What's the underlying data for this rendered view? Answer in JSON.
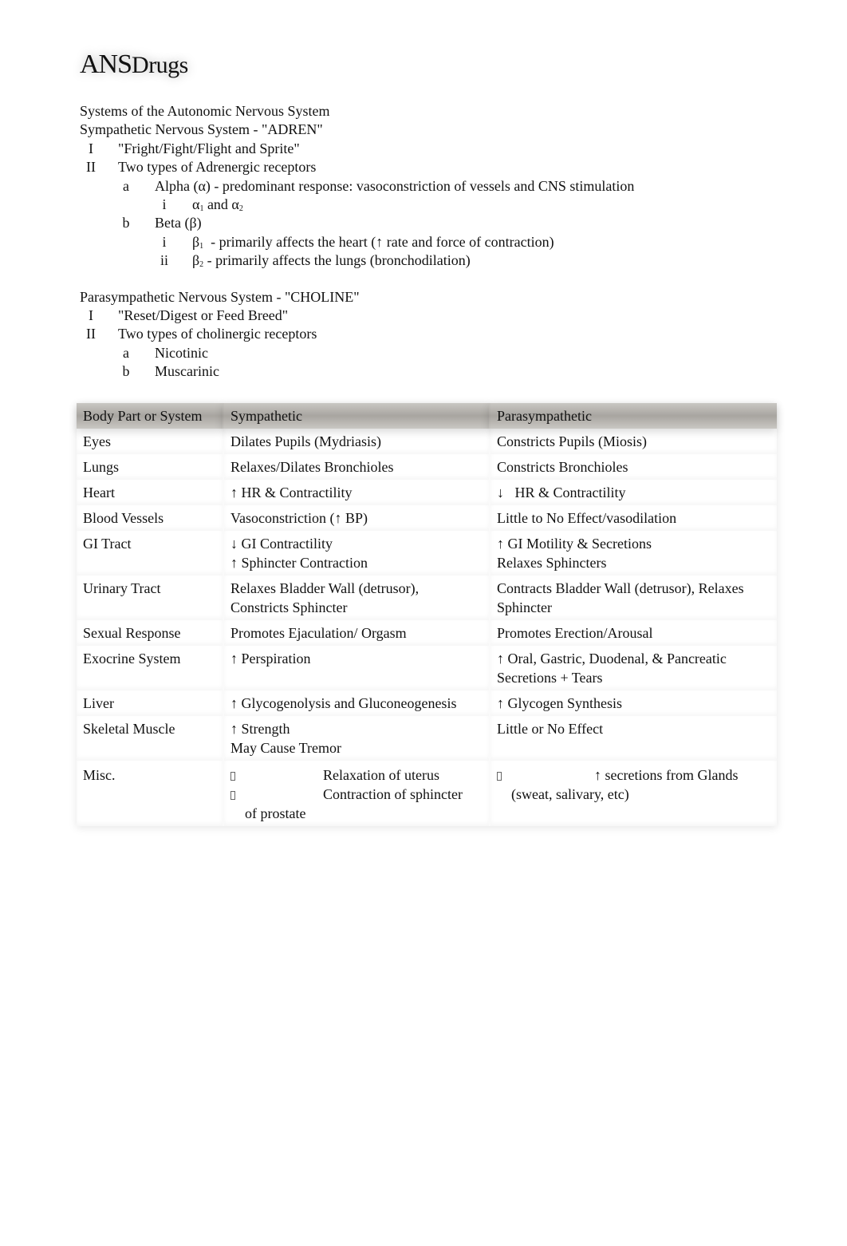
{
  "title": {
    "main": "ANS",
    "suffix": "Drugs"
  },
  "outline": {
    "heading": "Systems of the Autonomic Nervous System",
    "sympathetic": {
      "heading": "Sympathetic Nervous System  - \"ADREN\"",
      "items": [
        {
          "num": "I",
          "text": "\"Fright/Fight/Flight and Sprite\""
        },
        {
          "num": "II",
          "text": "Two types of Adrenergic receptors"
        }
      ],
      "alpha": {
        "num": "a",
        "text": "Alpha (α) - predominant response: vasoconstriction of vessels and CNS stimulation"
      },
      "alpha_sub": {
        "num": "i",
        "a": "α",
        "s1": "1",
        "mid": " and α",
        "s2": "2"
      },
      "beta": {
        "num": "b",
        "text": "Beta (β)"
      },
      "beta1": {
        "num": "i",
        "sym": "β",
        "sub": "1",
        "text": "  - primarily affects the heart (↑ rate and force of contraction)"
      },
      "beta2": {
        "num": "ii",
        "sym": "β",
        "sub": "2",
        "text": " - primarily affects the lungs (bronchodilation)"
      }
    },
    "parasympathetic": {
      "heading": "Parasympathetic Nervous System  - \"CHOLINE\"",
      "items": [
        {
          "num": "I",
          "text": "\"Reset/Digest or Feed Breed\""
        },
        {
          "num": "II",
          "text": "Two types of cholinergic receptors"
        }
      ],
      "subitems": [
        {
          "num": "a",
          "text": "Nicotinic"
        },
        {
          "num": "b",
          "text": "Muscarinic"
        }
      ]
    }
  },
  "table": {
    "headers": [
      "Body Part or System",
      "Sympathetic",
      "Parasympathetic"
    ],
    "rows": [
      {
        "part": "Eyes",
        "sym": [
          "Dilates Pupils (Mydriasis)"
        ],
        "para": [
          "Constricts Pupils (Miosis)"
        ]
      },
      {
        "part": "Lungs",
        "sym": [
          "Relaxes/Dilates Bronchioles"
        ],
        "para": [
          "Constricts Bronchioles"
        ]
      },
      {
        "part": "Heart",
        "sym": [
          "↑ HR & Contractility"
        ],
        "para": [
          "↓   HR & Contractility"
        ]
      },
      {
        "part": "Blood Vessels",
        "sym": [
          "Vasoconstriction (↑ BP)"
        ],
        "para": [
          "Little to No Effect/vasodilation"
        ]
      },
      {
        "part": "GI Tract",
        "sym": [
          "↓ GI Contractility",
          "↑ Sphincter Contraction"
        ],
        "para": [
          "↑ GI Motility & Secretions",
          "Relaxes Sphincters"
        ]
      },
      {
        "part": "Urinary Tract",
        "sym": [
          "Relaxes Bladder Wall (detrusor),",
          "Constricts Sphincter"
        ],
        "para": [
          "Contracts Bladder Wall (detrusor), Relaxes",
          "Sphincter"
        ]
      },
      {
        "part": "Sexual Response",
        "sym": [
          "Promotes Ejaculation/ Orgasm"
        ],
        "para": [
          "Promotes Erection/Arousal"
        ]
      },
      {
        "part": "Exocrine System",
        "sym": [
          "↑ Perspiration"
        ],
        "para": [
          "↑ Oral, Gastric, Duodenal, & Pancreatic",
          "Secretions + Tears"
        ]
      },
      {
        "part": "Liver",
        "sym": [
          "↑ Glycogenolysis and Gluconeogenesis"
        ],
        "para": [
          "↑ Glycogen Synthesis"
        ]
      },
      {
        "part": "Skeletal Muscle",
        "sym": [
          "↑ Strength",
          "May Cause Tremor"
        ],
        "para": [
          "Little or No Effect"
        ]
      }
    ],
    "misc": {
      "part": "Misc.",
      "sym_bullets": [
        "Relaxation of uterus",
        "Contraction of sphincter"
      ],
      "sym_cont": "of prostate",
      "para_bullets": [
        "↑ secretions from Glands"
      ],
      "para_cont": "(sweat, salivary, etc)"
    }
  }
}
